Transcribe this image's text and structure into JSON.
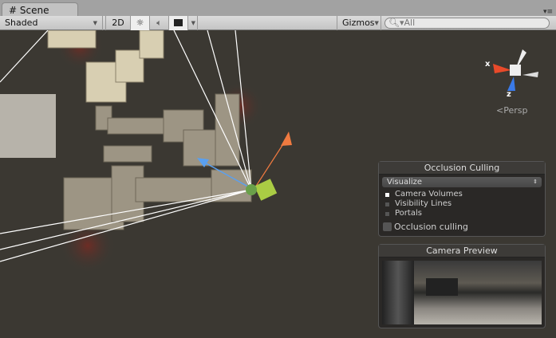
{
  "tab": {
    "title": "Scene",
    "icon": "grid-icon"
  },
  "toolbar": {
    "shading": "Shaded",
    "mode_2d": "2D",
    "gizmos": "Gizmos",
    "search_placeholder": "All"
  },
  "gizmo": {
    "x_label": "x",
    "z_label": "z",
    "projection": "Persp"
  },
  "occlusion": {
    "title": "Occlusion Culling",
    "visualize": "Visualize",
    "items": [
      {
        "label": "Camera Volumes",
        "on": true
      },
      {
        "label": "Visibility Lines",
        "on": false
      },
      {
        "label": "Portals",
        "on": false
      }
    ],
    "toggle_label": "Occlusion culling",
    "toggle_checked": false
  },
  "preview": {
    "title": "Camera Preview"
  }
}
